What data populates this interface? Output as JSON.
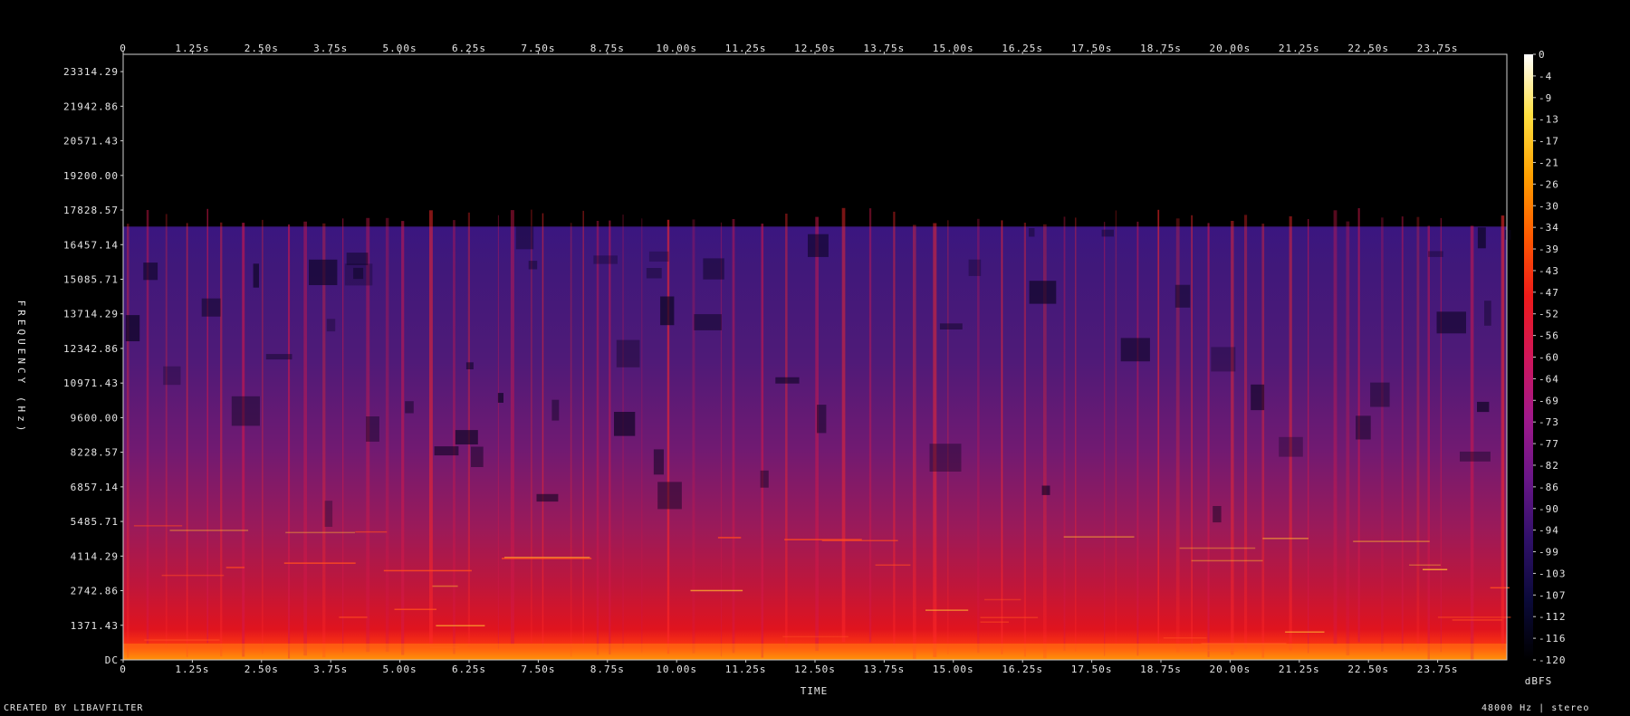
{
  "chart_data": {
    "type": "heatmap",
    "title": "",
    "xlabel": "TIME",
    "ylabel": "FREQUENCY (Hz)",
    "x_ticks": [
      "0",
      "1.25s",
      "2.50s",
      "3.75s",
      "5.00s",
      "6.25s",
      "7.50s",
      "8.75s",
      "10.00s",
      "11.25s",
      "12.50s",
      "13.75s",
      "15.00s",
      "16.25s",
      "17.50s",
      "18.75s",
      "20.00s",
      "21.25s",
      "22.50s",
      "23.75s"
    ],
    "x_range": [
      0,
      25
    ],
    "y_ticks": [
      "DC",
      "1371.43",
      "2742.86",
      "4114.29",
      "5485.71",
      "6857.14",
      "8228.57",
      "9600.00",
      "10971.43",
      "12342.86",
      "13714.29",
      "15085.71",
      "16457.14",
      "17828.57",
      "19200.00",
      "20571.43",
      "21942.86",
      "23314.29"
    ],
    "y_range": [
      0,
      24000
    ],
    "colorbar": {
      "label": "dBFS",
      "ticks": [
        "0",
        "-4",
        "-9",
        "-13",
        "-17",
        "-21",
        "-26",
        "-30",
        "-34",
        "-39",
        "-43",
        "-47",
        "-52",
        "-56",
        "-60",
        "-64",
        "-69",
        "-73",
        "-77",
        "-82",
        "-86",
        "-90",
        "-94",
        "-99",
        "-103",
        "-107",
        "-112",
        "-116",
        "-120"
      ],
      "range": [
        -120,
        0
      ],
      "colors": [
        "#000000",
        "#0b0a3a",
        "#30106a",
        "#6a1688",
        "#a0188a",
        "#d0165a",
        "#ee1a1a",
        "#ff5a00",
        "#ffa000",
        "#ffe040",
        "#ffffff"
      ]
    },
    "content_cutoff_hz": 17200,
    "footer_left": "CREATED BY LIBAVFILTER",
    "footer_right": "48000 Hz | stereo"
  }
}
